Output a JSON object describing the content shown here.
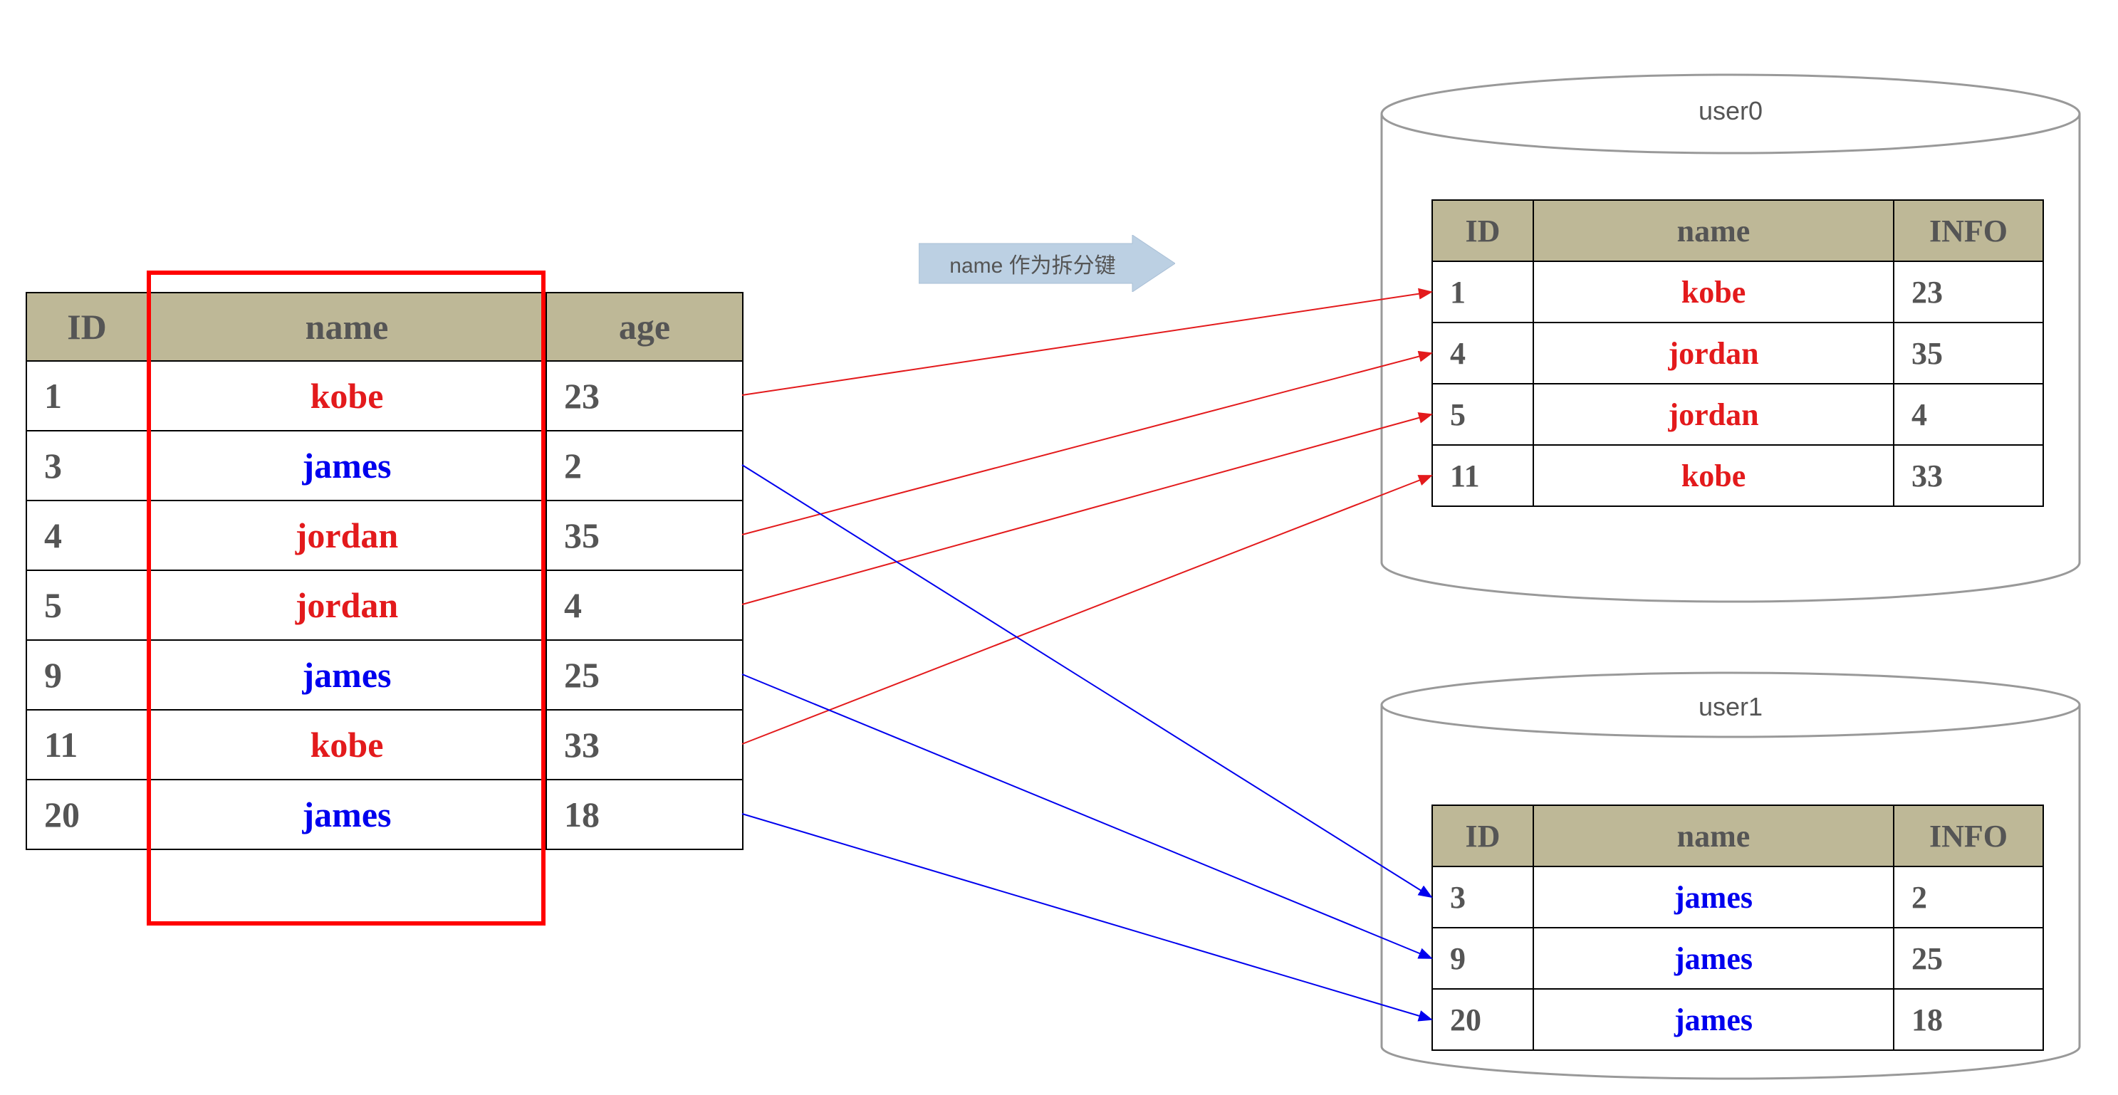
{
  "arrowLabel": "name 作为拆分键",
  "cylinder0Label": "user0",
  "cylinder1Label": "user1",
  "sourceTable": {
    "headers": [
      "ID",
      "name",
      "age"
    ],
    "rows": [
      {
        "id": "1",
        "name": "kobe",
        "age": "23",
        "color": "red"
      },
      {
        "id": "3",
        "name": "james",
        "age": "2",
        "color": "blue"
      },
      {
        "id": "4",
        "name": "jordan",
        "age": "35",
        "color": "red"
      },
      {
        "id": "5",
        "name": "jordan",
        "age": "4",
        "color": "red"
      },
      {
        "id": "9",
        "name": "james",
        "age": "25",
        "color": "blue"
      },
      {
        "id": "11",
        "name": "kobe",
        "age": "33",
        "color": "red"
      },
      {
        "id": "20",
        "name": "james",
        "age": "18",
        "color": "blue"
      }
    ]
  },
  "destTable0": {
    "headers": [
      "ID",
      "name",
      "INFO"
    ],
    "rows": [
      {
        "id": "1",
        "name": "kobe",
        "info": "23",
        "color": "red"
      },
      {
        "id": "4",
        "name": "jordan",
        "info": "35",
        "color": "red"
      },
      {
        "id": "5",
        "name": "jordan",
        "info": "4",
        "color": "red"
      },
      {
        "id": "11",
        "name": "kobe",
        "info": "33",
        "color": "red"
      }
    ]
  },
  "destTable1": {
    "headers": [
      "ID",
      "name",
      "INFO"
    ],
    "rows": [
      {
        "id": "3",
        "name": "james",
        "info": "2",
        "color": "blue"
      },
      {
        "id": "9",
        "name": "james",
        "info": "25",
        "color": "blue"
      },
      {
        "id": "20",
        "name": "james",
        "info": "18",
        "color": "blue"
      }
    ]
  },
  "chart_data": {
    "type": "table",
    "title": "Database horizontal partitioning (sharding) by 'name' column",
    "partitionKey": "name",
    "sourceTable": {
      "columns": [
        "ID",
        "name",
        "age"
      ],
      "data": [
        [
          1,
          "kobe",
          23
        ],
        [
          3,
          "james",
          2
        ],
        [
          4,
          "jordan",
          35
        ],
        [
          5,
          "jordan",
          4
        ],
        [
          9,
          "james",
          25
        ],
        [
          11,
          "kobe",
          33
        ],
        [
          20,
          "james",
          18
        ]
      ]
    },
    "shards": [
      {
        "name": "user0",
        "columns": [
          "ID",
          "name",
          "INFO"
        ],
        "data": [
          [
            1,
            "kobe",
            23
          ],
          [
            4,
            "jordan",
            35
          ],
          [
            5,
            "jordan",
            4
          ],
          [
            11,
            "kobe",
            33
          ]
        ]
      },
      {
        "name": "user1",
        "columns": [
          "ID",
          "name",
          "INFO"
        ],
        "data": [
          [
            3,
            "james",
            2
          ],
          [
            9,
            "james",
            25
          ],
          [
            20,
            "james",
            18
          ]
        ]
      }
    ]
  }
}
